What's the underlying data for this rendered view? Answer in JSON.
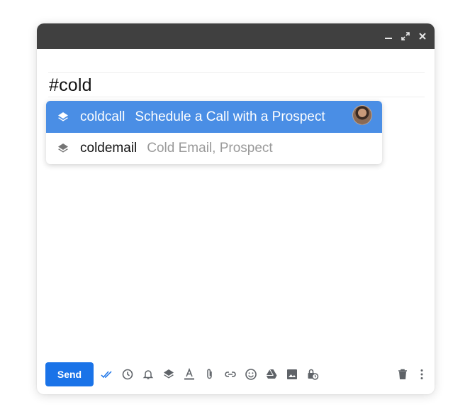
{
  "compose": {
    "body_text": "#cold",
    "window_controls": [
      "minimize-icon",
      "expand-icon",
      "close-icon"
    ]
  },
  "autocomplete": {
    "items": [
      {
        "shortcut": "coldcall",
        "description": "Schedule a Call with a Prospect",
        "icon": "layers-icon",
        "selected": true,
        "has_avatar": true
      },
      {
        "shortcut": "coldemail",
        "description": "Cold Email, Prospect",
        "icon": "layers-icon",
        "selected": false,
        "has_avatar": false
      }
    ]
  },
  "toolbar": {
    "send_label": "Send",
    "icons": [
      "double-check-icon",
      "clock-icon",
      "bell-icon",
      "layers-icon",
      "text-format-icon",
      "attachment-icon",
      "link-icon",
      "emoji-icon",
      "drive-icon",
      "image-icon",
      "confidential-icon",
      "trash-icon",
      "more-vert-icon"
    ]
  },
  "colors": {
    "titlebar": "#404040",
    "selected_item": "#4a8ee5",
    "send_button": "#1a73e8",
    "checkmark_accent": "#1a73e8"
  }
}
